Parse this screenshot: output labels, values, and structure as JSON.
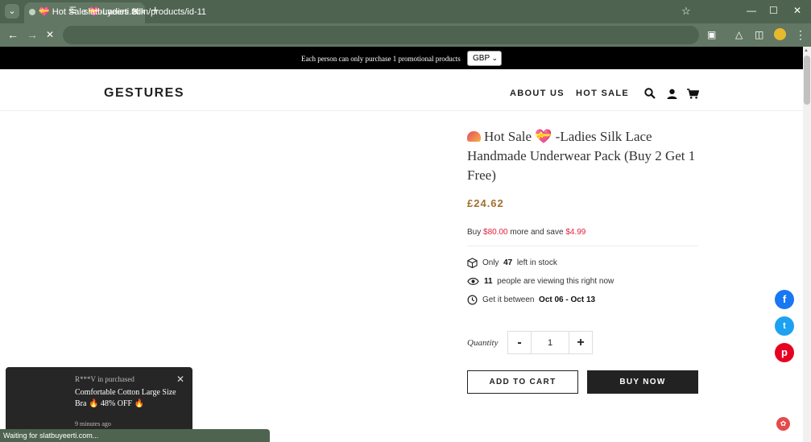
{
  "browser": {
    "tab_title": "💝 Hot Sale 💝-Ladies Silk Lace",
    "url": "slatbuyeerti.com/products/id-11",
    "status_text": "Waiting for slatbuyeerti.com...",
    "tab_menu_icon": "chevron-down-icon",
    "tab_close": "✕",
    "new_tab": "+",
    "minimize": "—",
    "maximize": "☐",
    "close": "✕",
    "back": "←",
    "forward": "→",
    "stop": "✕",
    "bookmark": "☆",
    "menu": "⋮"
  },
  "promo": {
    "text": "Each person can only purchase 1 promotional products",
    "currency": "GBP"
  },
  "header": {
    "logo": "GESTURES",
    "nav": [
      "ABOUT US",
      "HOT SALE"
    ]
  },
  "product": {
    "title": "Hot Sale 💝 -Ladies Silk Lace Handmade Underwear Pack (Buy 2 Get 1 Free)",
    "price": "£24.62",
    "bundle": {
      "prefix": "Buy ",
      "amount": "$80.00",
      "middle": " more and save ",
      "savings": "$4.99"
    },
    "stock": {
      "prefix": "Only",
      "count": "47",
      "suffix": "left in stock"
    },
    "viewers": {
      "count": "11",
      "suffix": "people are viewing this right now"
    },
    "delivery": {
      "prefix": "Get it between",
      "range": "Oct 06 - Oct 13"
    },
    "quantity_label": "Quantity",
    "quantity_minus": "-",
    "quantity_value": "1",
    "quantity_plus": "+",
    "add_to_cart": "ADD TO CART",
    "buy_now": "BUY NOW"
  },
  "social": {
    "facebook": "f",
    "twitter": "t",
    "pinterest": "p"
  },
  "popup": {
    "buyer": "R***V in purchased",
    "product": "Comfortable Cotton Large Size Bra 🔥 48% OFF 🔥",
    "time": "9 minutes ago",
    "close": "✕"
  },
  "colors": {
    "chrome": "#4f6450",
    "chrome_light": "#637864",
    "price": "#a0702e",
    "accent_red": "#e2223f"
  }
}
